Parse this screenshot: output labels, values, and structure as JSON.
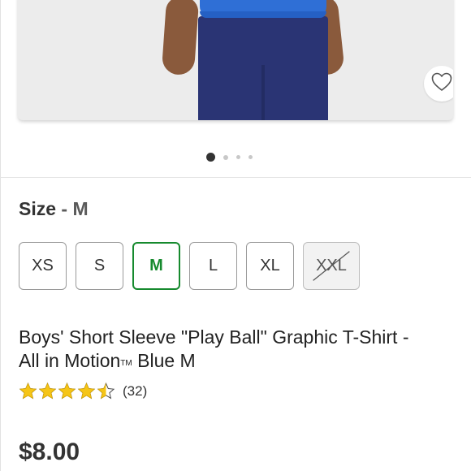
{
  "product": {
    "size_heading": {
      "label": "Size",
      "separator": "-",
      "value": "M"
    },
    "sizes": [
      {
        "label": "XS",
        "state": "available"
      },
      {
        "label": "S",
        "state": "available"
      },
      {
        "label": "M",
        "state": "selected"
      },
      {
        "label": "L",
        "state": "available"
      },
      {
        "label": "XL",
        "state": "available"
      },
      {
        "label": "XXL",
        "state": "unavailable"
      }
    ],
    "title_line1": "Boys' Short Sleeve \"Play Ball\" Graphic T-Shirt -",
    "title_line2_prefix": "All in Motion",
    "title_trademark": "TM",
    "title_line2_suffix": " Blue M",
    "rating_value": 4.5,
    "rating_max": 5,
    "review_count": "(32)",
    "price": "$8.00"
  },
  "gallery": {
    "current_image": 1,
    "total_images": 4
  },
  "colors": {
    "selected_accent": "#168a2e",
    "star": "#f5c518",
    "price_text": "#333333"
  },
  "icons": {
    "favorite": "heart-outline-icon",
    "rating": "star-icon"
  }
}
